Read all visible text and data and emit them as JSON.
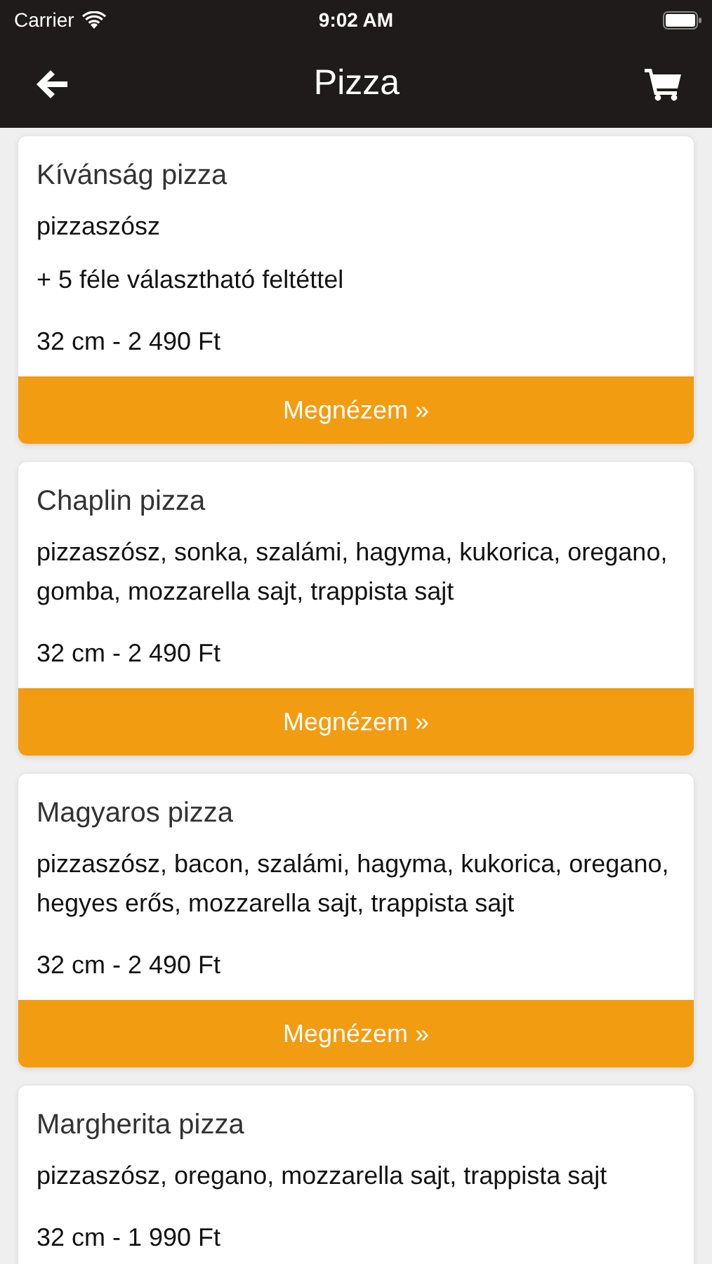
{
  "status_bar": {
    "carrier": "Carrier",
    "time": "9:02 AM"
  },
  "nav": {
    "title": "Pizza"
  },
  "products": [
    {
      "name": "Kívánság pizza",
      "lines": [
        "pizzaszósz",
        "+ 5 féle választható feltéttel"
      ],
      "price": "32 cm - 2 490 Ft",
      "button": "Megnézem »"
    },
    {
      "name": "Chaplin pizza",
      "lines": [
        "pizzaszósz, sonka, szalámi, hagyma, kukorica, oregano, gomba, mozzarella sajt, trappista sajt"
      ],
      "price": "32 cm - 2 490 Ft",
      "button": "Megnézem »"
    },
    {
      "name": "Magyaros pizza",
      "lines": [
        "pizzaszósz, bacon, szalámi, hagyma, kukorica, oregano, hegyes erős, mozzarella sajt, trappista sajt"
      ],
      "price": "32 cm - 2 490 Ft",
      "button": "Megnézem »"
    },
    {
      "name": "Margherita pizza",
      "lines": [
        "pizzaszósz, oregano, mozzarella sajt, trappista sajt"
      ],
      "price": "32 cm - 1 990 Ft"
    }
  ]
}
